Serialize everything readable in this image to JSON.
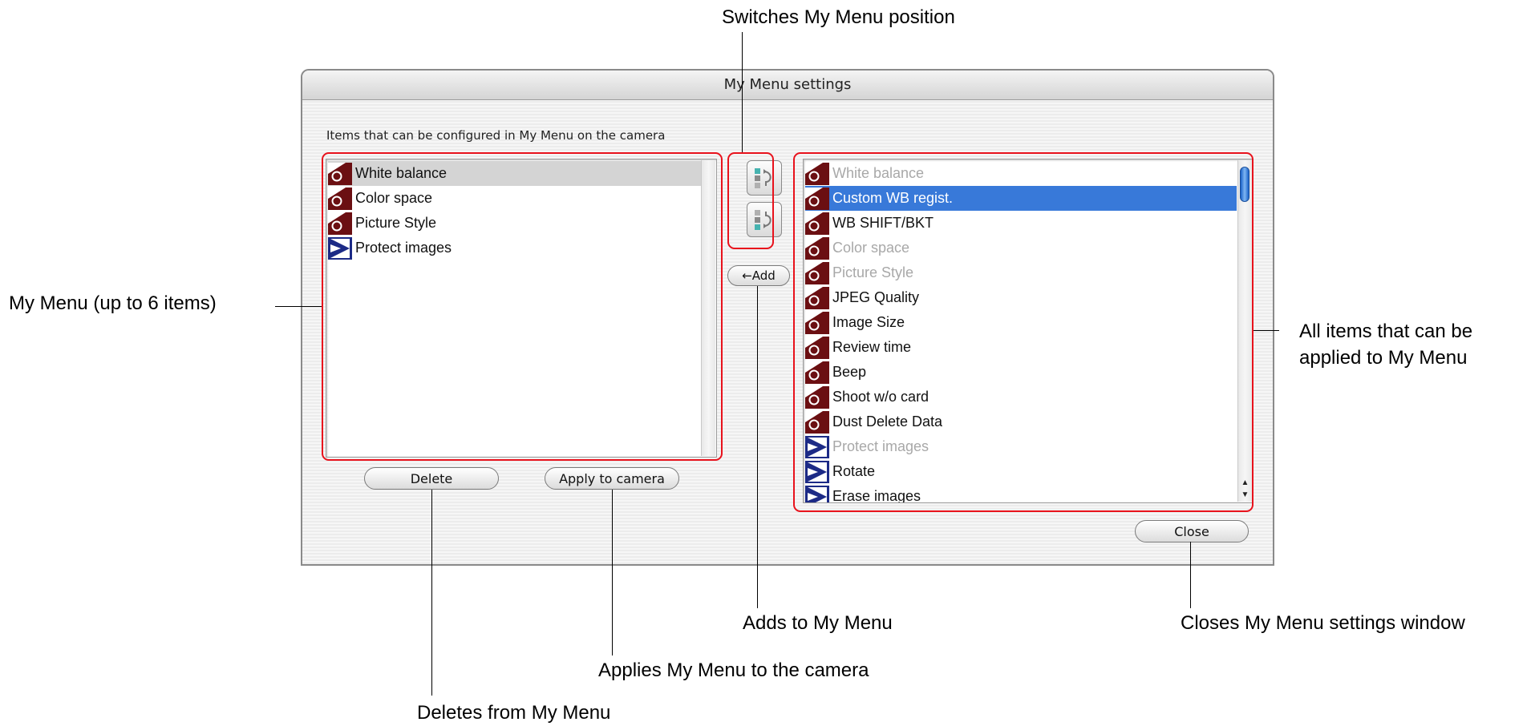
{
  "window": {
    "title": "My Menu settings"
  },
  "section_label": "Items that can be configured in My Menu on the camera",
  "my_menu": {
    "items": [
      {
        "label": "White balance",
        "icon": "camera-shooting-icon",
        "selected": true
      },
      {
        "label": "Color space",
        "icon": "camera-shooting-icon"
      },
      {
        "label": "Picture Style",
        "icon": "camera-shooting-icon"
      },
      {
        "label": "Protect images",
        "icon": "playback-icon"
      }
    ]
  },
  "all_items": {
    "items": [
      {
        "label": "White balance",
        "icon": "camera-shooting-icon",
        "disabled": true
      },
      {
        "label": "Custom WB regist.",
        "icon": "camera-shooting-icon",
        "selected": true
      },
      {
        "label": "WB SHIFT/BKT",
        "icon": "camera-shooting-icon"
      },
      {
        "label": "Color space",
        "icon": "camera-shooting-icon",
        "disabled": true
      },
      {
        "label": "Picture Style",
        "icon": "camera-shooting-icon",
        "disabled": true
      },
      {
        "label": "JPEG Quality",
        "icon": "camera-shooting-icon"
      },
      {
        "label": "Image Size",
        "icon": "camera-shooting-icon"
      },
      {
        "label": "Review time",
        "icon": "camera-shooting-icon"
      },
      {
        "label": "Beep",
        "icon": "camera-shooting-icon"
      },
      {
        "label": "Shoot w/o card",
        "icon": "camera-shooting-icon"
      },
      {
        "label": "Dust Delete Data",
        "icon": "camera-shooting-icon"
      },
      {
        "label": "Protect images",
        "icon": "playback-icon",
        "disabled": true
      },
      {
        "label": "Rotate",
        "icon": "playback-icon"
      },
      {
        "label": "Erase images",
        "icon": "playback-icon"
      }
    ]
  },
  "buttons": {
    "delete": "Delete",
    "apply": "Apply to camera",
    "add": "←Add",
    "close": "Close",
    "move_up_icon": "move-up-icon",
    "move_down_icon": "move-down-icon"
  },
  "callouts": {
    "switch_position": "Switches My Menu position",
    "my_menu": "My Menu (up to 6 items)",
    "all_items_line1": "All items that can be",
    "all_items_line2": "applied to My Menu",
    "adds": "Adds to My Menu",
    "closes": "Closes My Menu settings window",
    "applies": "Applies My Menu to the camera",
    "deletes": "Deletes from My Menu"
  },
  "colors": {
    "highlight": "#e8121c",
    "selection_blue": "#3879d9",
    "shooting_icon": "#6b0f12",
    "playback_icon": "#1c2a86"
  }
}
